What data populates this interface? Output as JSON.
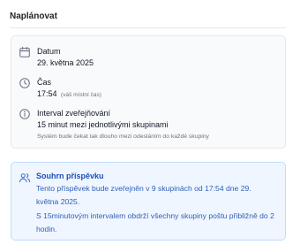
{
  "section": {
    "title": "Naplánovat"
  },
  "schedule": {
    "date": {
      "icon": "calendar-icon",
      "label": "Datum",
      "value": "29. května 2025"
    },
    "time": {
      "icon": "clock-icon",
      "label": "Čas",
      "value": "17:54",
      "note": "(váš místní čas)"
    },
    "interval": {
      "icon": "info-icon",
      "label": "Interval zveřejňování",
      "value": "15 minut mezi jednotlivými skupinami",
      "hint": "Systém bude čekat tak dlouho mezi odesláním do každé skupiny"
    }
  },
  "summary": {
    "icon": "users-icon",
    "title": "Souhrn příspěvku",
    "line1": "Tento příspěvek bude zveřejněn v 9 skupinách od 17:54 dne 29. května 2025.",
    "line2": "S 15minutovým intervalem obdrží všechny skupiny poštu přibližně do 2 hodin."
  },
  "colors": {
    "summary_bg": "#eff6ff",
    "summary_border": "#bfdbfe",
    "summary_text": "#2f5fb8",
    "card_bg": "#f9fafb"
  }
}
